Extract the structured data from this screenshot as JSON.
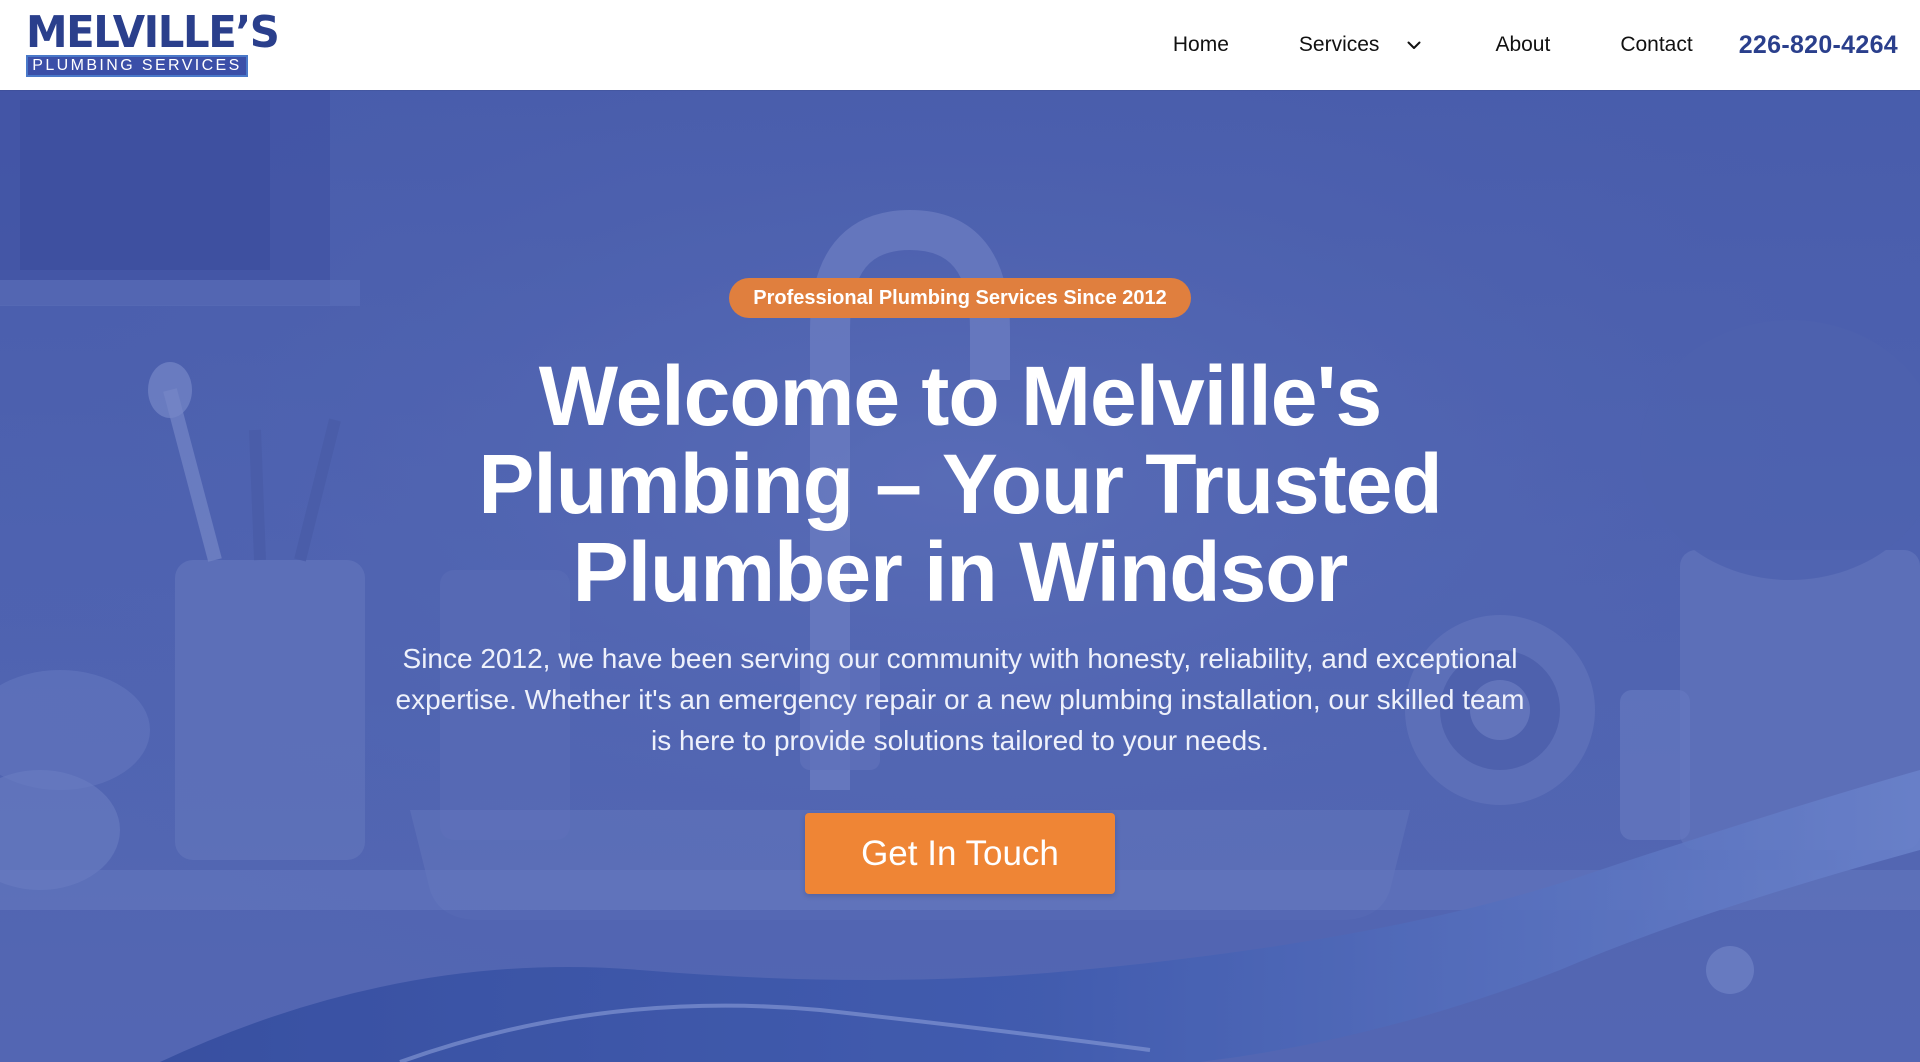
{
  "brand": {
    "name": "MELVILLE’S",
    "tagline": "PLUMBING SERVICES",
    "colors": {
      "primary": "#2a3f8c",
      "accent": "#ef8535",
      "badge": "#e07f3e"
    }
  },
  "nav": {
    "items": [
      {
        "label": "Home"
      },
      {
        "label": "Services",
        "icon": "chevron-down-icon"
      },
      {
        "label": "About"
      },
      {
        "label": "Contact"
      }
    ],
    "phone": "226-820-4264"
  },
  "hero": {
    "badge": "Professional Plumbing Services Since 2012",
    "title": "Welcome to Melville's Plumbing – Your Trusted Plumber in Windsor",
    "description": "Since 2012, we have been serving our community with honesty, reliability, and exceptional expertise. Whether it's an emergency repair or a new plumbing installation, our skilled team is here to provide solutions tailored to your needs.",
    "cta_label": "Get In Touch"
  }
}
